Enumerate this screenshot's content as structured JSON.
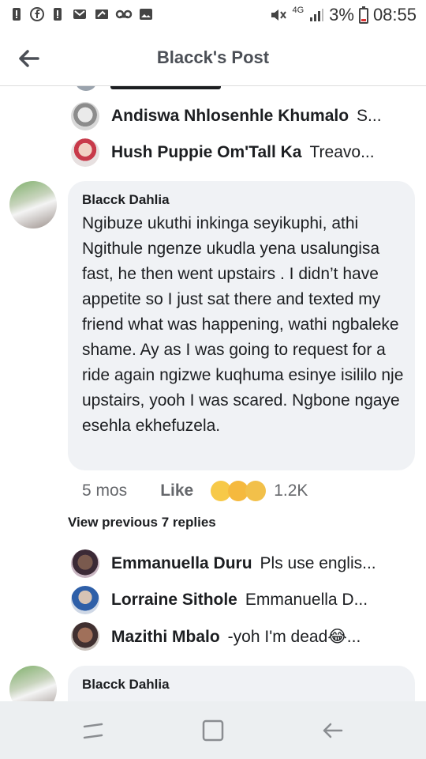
{
  "status_bar": {
    "left_icons": [
      "alert-icon",
      "facebook-icon",
      "alert-icon",
      "gmail-icon",
      "image-edit-icon",
      "voicemail-icon",
      "gallery-icon"
    ],
    "network": "4G",
    "battery": "3%",
    "time": "08:55"
  },
  "app_bar": {
    "title": "Blacck's Post"
  },
  "replies_top": [
    {
      "name": "Andiswa Nhlosenhle Khumalo",
      "text": "S..."
    },
    {
      "name": "Hush Puppie Om'Tall Ka",
      "text": "Treavo..."
    }
  ],
  "comments": [
    {
      "author": "Blacck Dahlia",
      "text": "Ngibuze ukuthi inkinga seyikuphi, athi Ngithule ngenze ukudla yena usalungisa fast, he then went upstairs . I didn’t have appetite so I just sat there and texted my friend what was happening, wathi ngbaleke shame. Ay as I was going to request for a ride again ngizwe kuqhuma esinye isililo nje upstairs, yooh I was scared. Ngbone ngaye esehla ekhefuzela.",
      "time": "5 mos",
      "like": "Like",
      "reaction_count": "1.2K"
    },
    {
      "author": "Blacck Dahlia",
      "text": ""
    }
  ],
  "view_previous": "View previous 7 replies",
  "replies_bottom": [
    {
      "name": "Emmanuella Duru",
      "text": "Pls use englis..."
    },
    {
      "name": "Lorraine Sithole",
      "text": "Emmanuella D..."
    },
    {
      "name": "Mazithi Mbalo",
      "text": "-yoh I'm dead😂..."
    }
  ],
  "colors": {
    "bubble": "#f0f2f5",
    "nav_bar": "#eceff1",
    "meta": "#65676b"
  }
}
